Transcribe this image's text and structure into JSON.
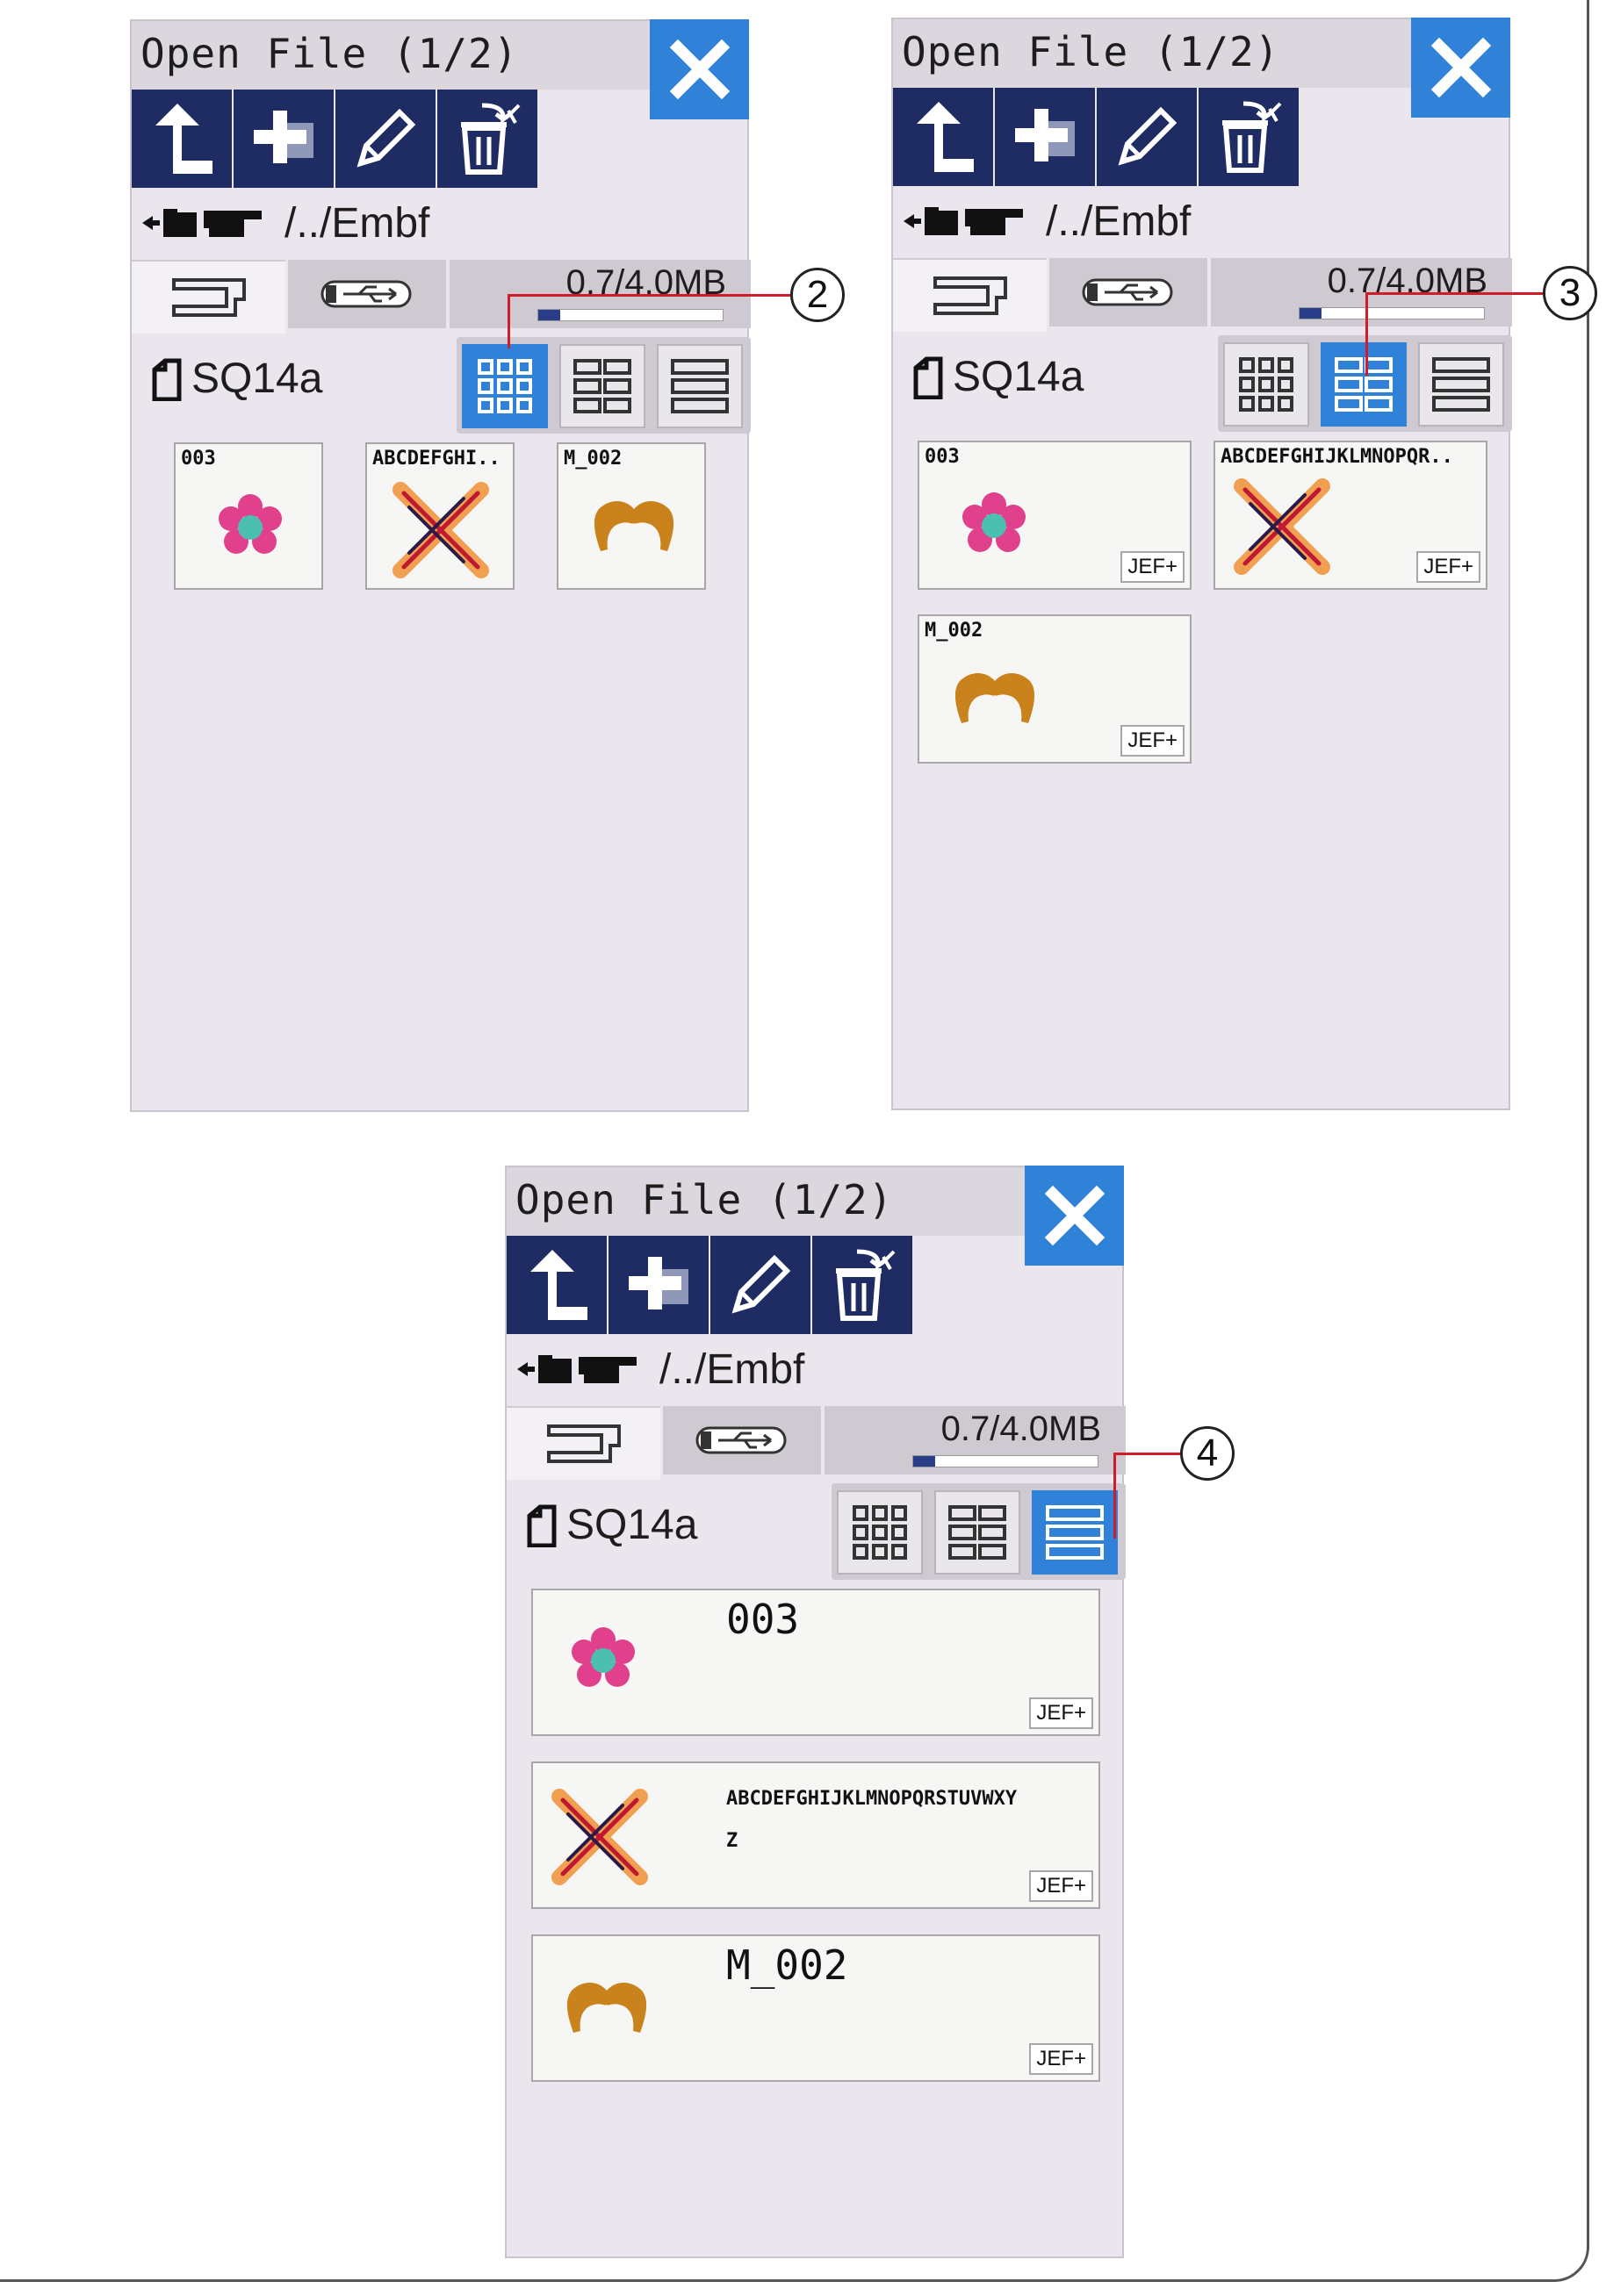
{
  "window": {
    "title": "Open File (1/2)"
  },
  "toolbar": {
    "buttons": [
      {
        "icon": "up-arrow-icon"
      },
      {
        "icon": "new-folder-icon"
      },
      {
        "icon": "pencil-icon"
      },
      {
        "icon": "trash-icon"
      }
    ]
  },
  "path": {
    "text": "/../Embf"
  },
  "memory": {
    "text": "0.7/4.0MB",
    "used_fraction": 0.12
  },
  "folder": {
    "name": "SQ14a"
  },
  "files": [
    {
      "name": "003",
      "short": "003",
      "tag": "JEF+",
      "icon": "flower-icon"
    },
    {
      "name": "ABCDEFGHIJKLMNOPQRSTUVWXY",
      "name_line2": "Z",
      "short": "ABCDEFGHI..",
      "medium": "ABCDEFGHIJKLMNOPQR..",
      "tag": "JEF+",
      "icon": "cross-stitch-icon"
    },
    {
      "name": "M_002",
      "short": "M_002",
      "tag": "JEF+",
      "icon": "mustache-icon"
    }
  ],
  "callouts": [
    "2",
    "3",
    "4"
  ],
  "colors": {
    "accent": "#2f82d8",
    "toolbar": "#1e2c63",
    "panel": "#ebe6ee"
  }
}
